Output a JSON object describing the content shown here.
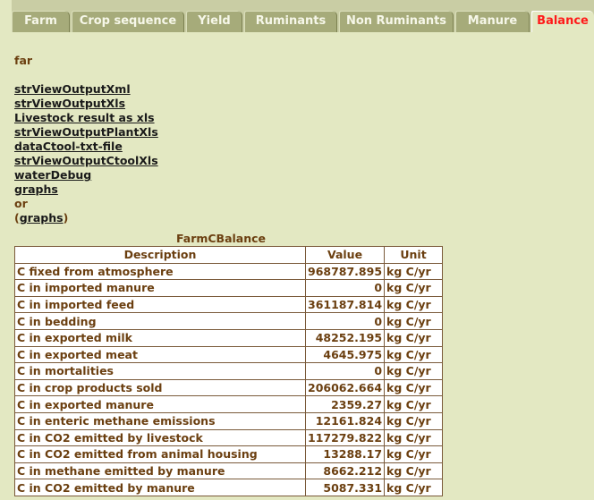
{
  "tabs": [
    {
      "label": "Farm",
      "active": false
    },
    {
      "label": "Crop sequence",
      "active": false
    },
    {
      "label": "Yield",
      "active": false
    },
    {
      "label": "Ruminants",
      "active": false
    },
    {
      "label": "Non Ruminants",
      "active": false
    },
    {
      "label": "Manure",
      "active": false
    },
    {
      "label": "Balance",
      "active": true
    }
  ],
  "farm_label": "far",
  "links": [
    "strViewOutputXml",
    "strViewOutputXls",
    "Livestock result as xls",
    "strViewOutputPlantXls",
    "dataCtool-txt-file",
    "strViewOutputCtoolXls",
    "waterDebug",
    "graphs"
  ],
  "or_text": "or",
  "paren_open": "(",
  "paren_link": "graphs",
  "paren_close": ")",
  "table": {
    "title": "FarmCBalance",
    "headers": [
      "Description",
      "Value",
      "Unit"
    ],
    "rows": [
      {
        "description": "C fixed from atmosphere",
        "value": "968787.895",
        "unit": "kg C/yr"
      },
      {
        "description": "C in imported manure",
        "value": "0",
        "unit": "kg C/yr"
      },
      {
        "description": "C in imported feed",
        "value": "361187.814",
        "unit": "kg C/yr"
      },
      {
        "description": "C in bedding",
        "value": "0",
        "unit": "kg C/yr"
      },
      {
        "description": "C in exported milk",
        "value": "48252.195",
        "unit": "kg C/yr"
      },
      {
        "description": "C in exported meat",
        "value": "4645.975",
        "unit": "kg C/yr"
      },
      {
        "description": "C in mortalities",
        "value": "0",
        "unit": "kg C/yr"
      },
      {
        "description": "C in crop products sold",
        "value": "206062.664",
        "unit": "kg C/yr"
      },
      {
        "description": "C in exported manure",
        "value": "2359.27",
        "unit": "kg C/yr"
      },
      {
        "description": "C in enteric methane emissions",
        "value": "12161.824",
        "unit": "kg C/yr"
      },
      {
        "description": "C in CO2 emitted by livestock",
        "value": "117279.822",
        "unit": "kg C/yr"
      },
      {
        "description": "C in CO2 emitted from animal housing",
        "value": "13288.17",
        "unit": "kg C/yr"
      },
      {
        "description": "C in methane emitted by manure",
        "value": "8662.212",
        "unit": "kg C/yr"
      },
      {
        "description": "C in CO2 emitted by manure",
        "value": "5087.331",
        "unit": "kg C/yr"
      }
    ]
  }
}
